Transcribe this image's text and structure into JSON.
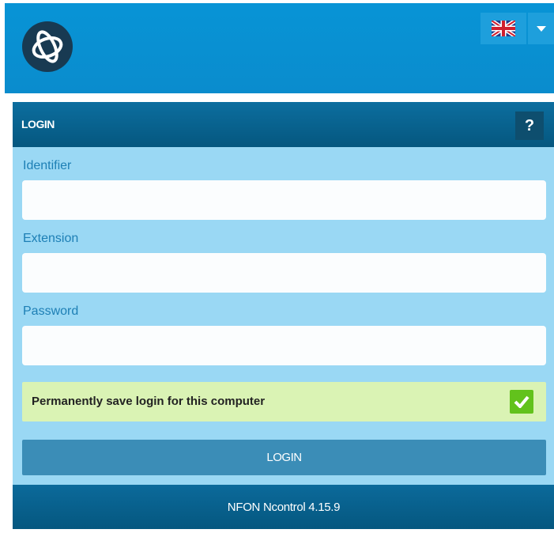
{
  "header": {
    "logo": "nfon-orbit-logo",
    "language_flag": "uk-flag-icon",
    "language_dropdown": "chevron-down-icon"
  },
  "panel": {
    "title": "LOGIN",
    "help_label": "?"
  },
  "form": {
    "identifier_label": "Identifier",
    "identifier_value": "",
    "extension_label": "Extension",
    "extension_value": "",
    "password_label": "Password",
    "password_value": "",
    "save_label": "Permanently save login for this computer",
    "save_checked": true,
    "login_button": "LOGIN"
  },
  "footer": {
    "version": "NFON Ncontrol 4.15.9"
  },
  "colors": {
    "header": "#0894d6",
    "panel": "#9ad8f4",
    "panel_header": "#05577f",
    "save_row": "#daf3b4",
    "check": "#62c21c",
    "login_button": "#3b8db7"
  }
}
